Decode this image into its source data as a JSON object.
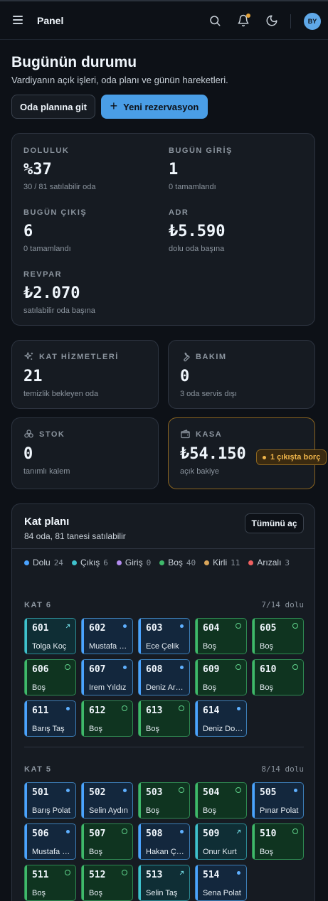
{
  "topbar": {
    "brand": "Panel",
    "avatar_initials": "BY",
    "notification_dot_color": "#e3a33b"
  },
  "header": {
    "title": "Bugünün durumu",
    "subtitle": "Vardiyanın açık işleri, oda planı ve günün hareketleri.",
    "btn_room_plan": "Oda planına git",
    "btn_new_reservation": "Yeni rezervasyon"
  },
  "stats": {
    "occupancy": {
      "label": "DOLULUK",
      "value": "%37",
      "note": "30 / 81 satılabilir oda"
    },
    "checkin": {
      "label": "BUGÜN GİRİŞ",
      "value": "1",
      "note": "0 tamamlandı"
    },
    "checkout": {
      "label": "BUGÜN ÇIKIŞ",
      "value": "6",
      "note": "0 tamamlandı"
    },
    "adr": {
      "label": "ADR",
      "value": "₺5.590",
      "note": "dolu oda başına"
    },
    "revpar": {
      "label": "REVPAR",
      "value": "₺2.070",
      "note": "satılabilir oda başına"
    }
  },
  "cards": {
    "housekeeping": {
      "label": "KAT HİZMETLERİ",
      "value": "21",
      "note": "temizlik bekleyen oda",
      "icon": "sparkles-icon"
    },
    "maintenance": {
      "label": "BAKIM",
      "value": "0",
      "note": "3 oda servis dışı",
      "icon": "wrench-icon"
    },
    "stock": {
      "label": "STOK",
      "value": "0",
      "note": "tanımlı kalem",
      "icon": "boxes-icon"
    },
    "cash": {
      "label": "KASA",
      "value": "₺54.150",
      "note": "açık bakiye",
      "badge": "1 çıkışta borç",
      "icon": "wallet-icon",
      "accent": "#f0b54a"
    }
  },
  "plan": {
    "title": "Kat planı",
    "subtitle": "84 oda, 81 tanesi satılabilir",
    "open_all": "Tümünü aç",
    "legend": [
      {
        "label": "Dolu",
        "count": "24",
        "color": "#4aa3ff"
      },
      {
        "label": "Çıkış",
        "count": "6",
        "color": "#3fc1cc"
      },
      {
        "label": "Giriş",
        "count": "0",
        "color": "#b48cf0"
      },
      {
        "label": "Boş",
        "count": "40",
        "color": "#3fb96a"
      },
      {
        "label": "Kirli",
        "count": "11",
        "color": "#d9a55a"
      },
      {
        "label": "Arızalı",
        "count": "3",
        "color": "#f06060"
      }
    ],
    "floors": [
      {
        "name": "KAT 6",
        "occupancy": "7/14 dolu",
        "rooms": [
          {
            "number": "601",
            "guest": "Tolga Koç",
            "status": "cikis"
          },
          {
            "number": "602",
            "guest": "Mustafa Polat",
            "status": "dolu"
          },
          {
            "number": "603",
            "guest": "Ece Çelik",
            "status": "dolu"
          },
          {
            "number": "604",
            "guest": "Boş",
            "status": "bos"
          },
          {
            "number": "605",
            "guest": "Boş",
            "status": "bos"
          },
          {
            "number": "606",
            "guest": "Boş",
            "status": "bos"
          },
          {
            "number": "607",
            "guest": "Irem Yıldız",
            "status": "dolu"
          },
          {
            "number": "608",
            "guest": "Deniz Arslan",
            "status": "dolu"
          },
          {
            "number": "609",
            "guest": "Boş",
            "status": "bos"
          },
          {
            "number": "610",
            "guest": "Boş",
            "status": "bos"
          },
          {
            "number": "611",
            "guest": "Barış Taş",
            "status": "dolu"
          },
          {
            "number": "612",
            "guest": "Boş",
            "status": "bos"
          },
          {
            "number": "613",
            "guest": "Boş",
            "status": "bos"
          },
          {
            "number": "614",
            "guest": "Deniz Doğan",
            "status": "dolu"
          }
        ]
      },
      {
        "name": "KAT 5",
        "occupancy": "8/14 dolu",
        "rooms": [
          {
            "number": "501",
            "guest": "Barış Polat",
            "status": "dolu"
          },
          {
            "number": "502",
            "guest": "Selin Aydın",
            "status": "dolu"
          },
          {
            "number": "503",
            "guest": "Boş",
            "status": "bos"
          },
          {
            "number": "504",
            "guest": "Boş",
            "status": "bos"
          },
          {
            "number": "505",
            "guest": "Pınar Polat",
            "status": "dolu"
          },
          {
            "number": "506",
            "guest": "Mustafa Kaya",
            "status": "dolu"
          },
          {
            "number": "507",
            "guest": "Boş",
            "status": "bos"
          },
          {
            "number": "508",
            "guest": "Hakan Çelik",
            "status": "dolu"
          },
          {
            "number": "509",
            "guest": "Onur Kurt",
            "status": "cikis"
          },
          {
            "number": "510",
            "guest": "Boş",
            "status": "bos"
          },
          {
            "number": "511",
            "guest": "Boş",
            "status": "bos"
          },
          {
            "number": "512",
            "guest": "Boş",
            "status": "bos"
          },
          {
            "number": "513",
            "guest": "Selin Taş",
            "status": "cikis"
          },
          {
            "number": "514",
            "guest": "Sena Polat",
            "status": "dolu"
          }
        ]
      }
    ]
  }
}
